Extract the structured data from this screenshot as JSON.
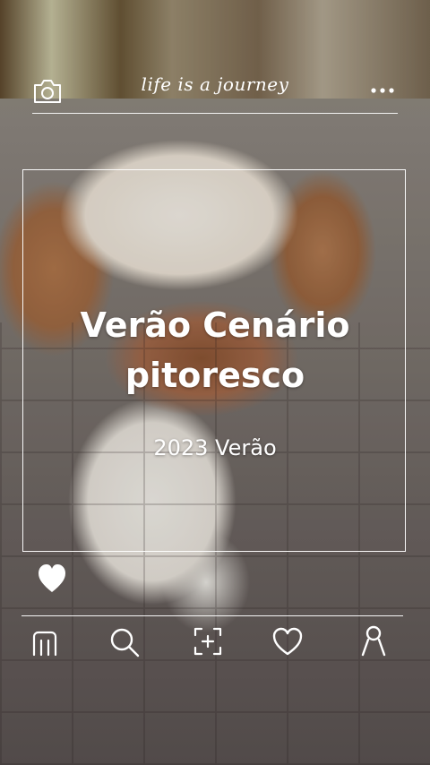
{
  "header": {
    "brand": "life is a journey",
    "camera_icon": "camera-icon",
    "more_icon": "more-dots-icon"
  },
  "card": {
    "title_line1": "Verão Cenário",
    "title_line2": "pitoresco",
    "subtitle": "2023 Verão",
    "like_icon": "heart-icon"
  },
  "bottom_nav": {
    "items": [
      {
        "icon": "home-icon"
      },
      {
        "icon": "search-icon"
      },
      {
        "icon": "add-photo-icon"
      },
      {
        "icon": "favorites-icon"
      },
      {
        "icon": "profile-icon"
      }
    ]
  },
  "colors": {
    "foreground": "#ffffff"
  }
}
